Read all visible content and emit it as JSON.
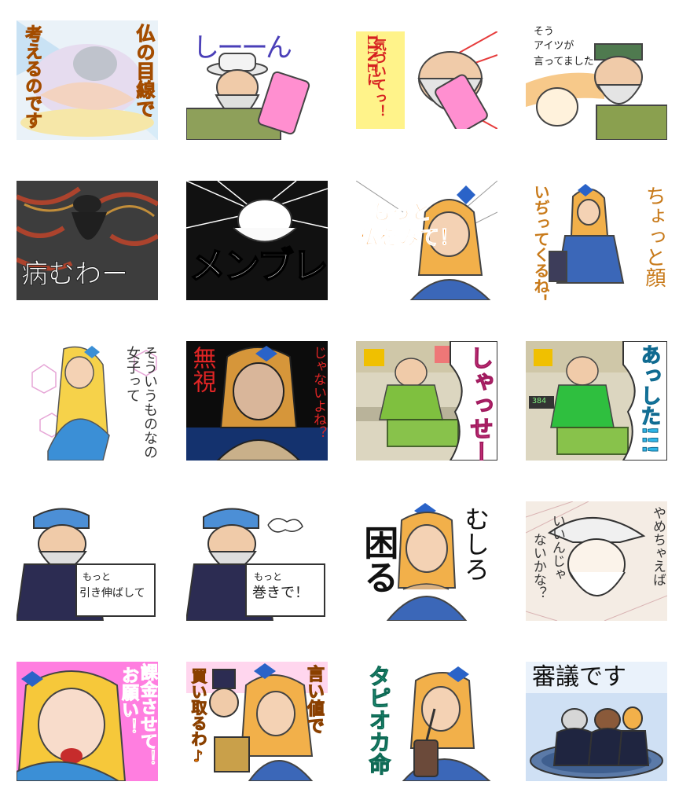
{
  "stickers": [
    {
      "id": 1,
      "caption": "仏の目線で考えるのです"
    },
    {
      "id": 2,
      "caption": "しーーん"
    },
    {
      "id": 3,
      "caption": "LINEに気づいてっ！"
    },
    {
      "id": 4,
      "caption": "そうアイツが言ってました"
    },
    {
      "id": 5,
      "caption": "病むわー"
    },
    {
      "id": 6,
      "caption": "メンブレ"
    },
    {
      "id": 7,
      "caption": "もっと私をみて！"
    },
    {
      "id": 8,
      "caption": "ちょっと顔いぢってくるね！"
    },
    {
      "id": 9,
      "caption": "女子ってそういうものなの"
    },
    {
      "id": 10,
      "caption": "無視じゃないよね？"
    },
    {
      "id": 11,
      "caption": "しゃっせー"
    },
    {
      "id": 12,
      "caption": "あっした!!!"
    },
    {
      "id": 13,
      "caption": "もっと引き伸ばして"
    },
    {
      "id": 14,
      "caption": "もっと巻きで！"
    },
    {
      "id": 15,
      "caption": "むしろ困る"
    },
    {
      "id": 16,
      "caption": "やめちゃえばいいんじゃないかな？"
    },
    {
      "id": 17,
      "caption": "お願い！課金させて！"
    },
    {
      "id": 18,
      "caption": "言い値で買い取るわ♪"
    },
    {
      "id": 19,
      "caption": "タピオカ命"
    },
    {
      "id": 20,
      "caption": "審議です"
    }
  ],
  "texts": {
    "s1a": "仏の目線で",
    "s1b": "考えるのです",
    "s2": "しーーん",
    "s3a": "LINEに",
    "s3b": "気づいてっ！",
    "s4a": "そう",
    "s4b": "アイツが",
    "s4c": "言ってました",
    "s5": "病むわー",
    "s6": "メンブレ",
    "s7a": "もっと",
    "s7b": "私をみて！",
    "s8a": "ちょっと顔",
    "s8b": "いぢってくるね！",
    "s9a": "女子って",
    "s9b": "そういうものなの",
    "s10a": "無視",
    "s10b": "じゃないよね？",
    "s11": "しゃっせー",
    "s12": "あっした!!!",
    "s13a": "もっと",
    "s13b": "引き伸ばして",
    "s14a": "もっと",
    "s14b": "巻きで！",
    "s15a": "むしろ",
    "s15b": "困る",
    "s16a": "やめちゃえば",
    "s16b": "いいんじゃ",
    "s16c": "ないかな？",
    "s17a": "お願い！",
    "s17b": "課金させて！",
    "s18a": "言い値で",
    "s18b": "買い取るわ♪",
    "s19": "タピオカ命",
    "s20": "審議です",
    "register": "384",
    "counter": "384"
  },
  "colors": {
    "border": "#888888",
    "orange": "#f08a00",
    "pink": "#e8408c",
    "blue_dress": "#3b67b8",
    "hair": "#f2b04a",
    "skin": "#f4d2b4",
    "green_vest": "#7aa84a"
  }
}
